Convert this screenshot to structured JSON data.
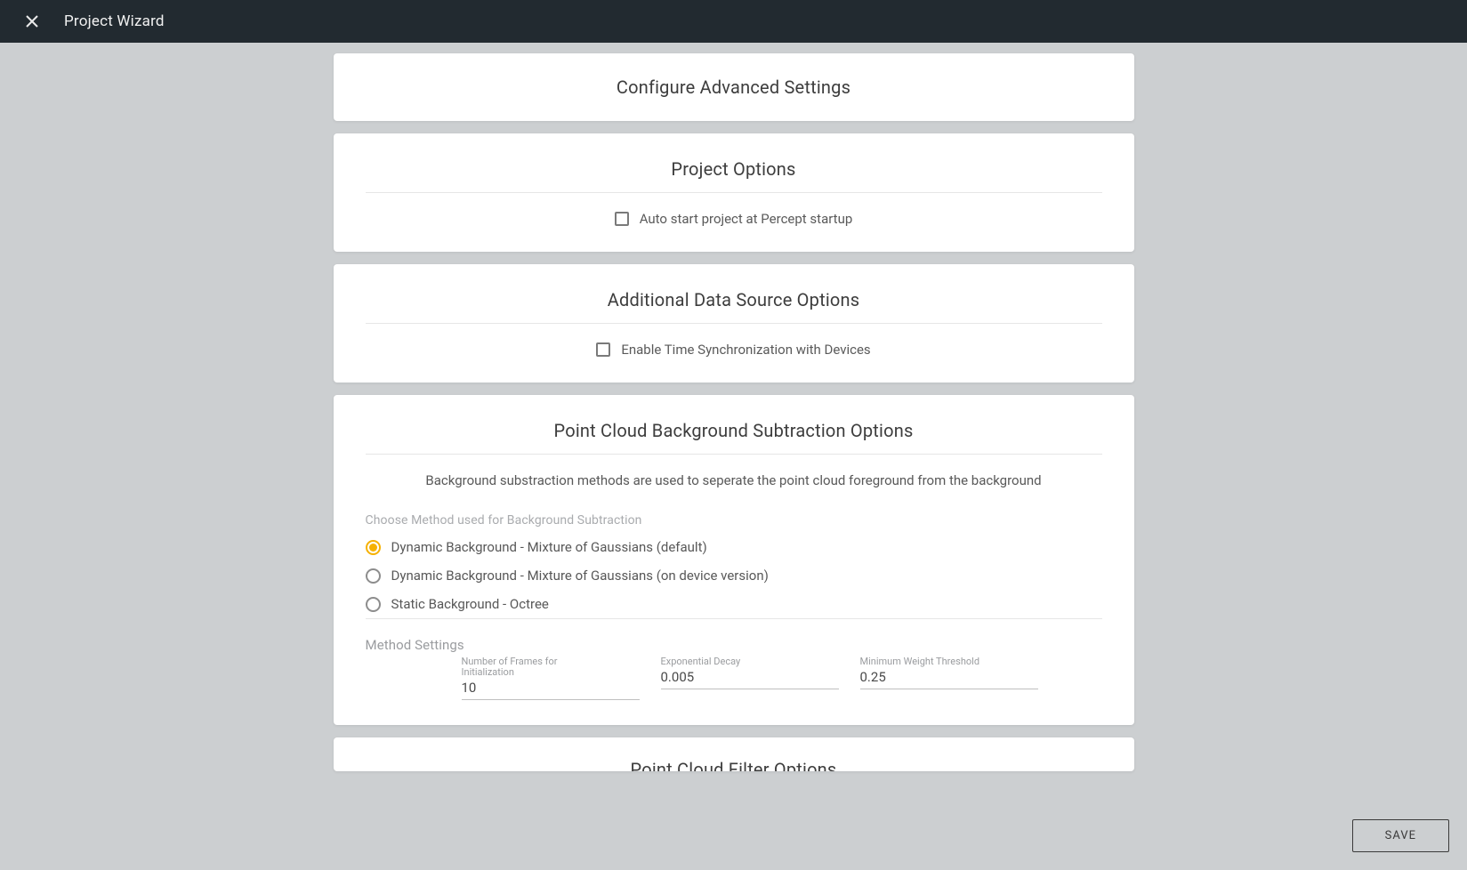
{
  "topbar": {
    "title": "Project Wizard"
  },
  "cards": {
    "advanced": {
      "title": "Configure Advanced Settings"
    },
    "project_options": {
      "title": "Project Options",
      "auto_start_label": "Auto start project at Percept startup",
      "auto_start_checked": false
    },
    "data_source": {
      "title": "Additional Data Source Options",
      "time_sync_label": "Enable Time Synchronization with Devices",
      "time_sync_checked": false
    },
    "bg_sub": {
      "title": "Point Cloud Background Subtraction Options",
      "description": "Background substraction methods are used to seperate the point cloud foreground from the background",
      "choose_label": "Choose Method used for Background Subtraction",
      "methods": [
        {
          "label": "Dynamic Background - Mixture of Gaussians (default)",
          "selected": true
        },
        {
          "label": "Dynamic Background - Mixture of Gaussians (on device version)",
          "selected": false
        },
        {
          "label": "Static Background - Octree",
          "selected": false
        }
      ],
      "method_settings_label": "Method Settings",
      "fields": {
        "frames": {
          "label": "Number of Frames for Initialization",
          "value": "10"
        },
        "decay": {
          "label": "Exponential Decay",
          "value": "0.005"
        },
        "weight": {
          "label": "Minimum Weight Threshold",
          "value": "0.25"
        }
      }
    },
    "filter": {
      "title": "Point Cloud Filter Options"
    }
  },
  "buttons": {
    "save": "SAVE"
  },
  "colors": {
    "accent": "#f6b100",
    "topbar": "#222a30",
    "page_bg": "#cccfd1"
  }
}
